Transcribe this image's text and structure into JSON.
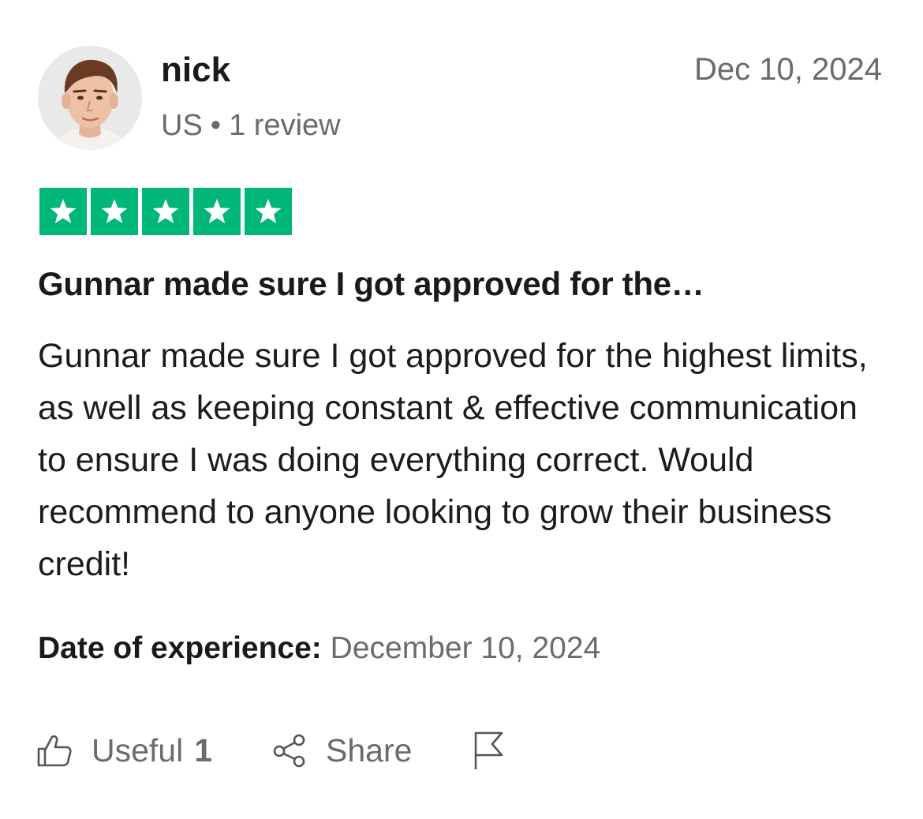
{
  "review": {
    "author": "nick",
    "country": "US",
    "separator": "•",
    "review_count": "1 review",
    "date": "Dec 10, 2024",
    "rating": 5,
    "rating_max": 5,
    "star_color": "#00b67a",
    "title": "Gunnar made sure I got approved for the…",
    "body": "Gunnar made sure I got approved for the highest limits, as well as keeping constant & effective communication to ensure I was doing everything correct. Would recommend to anyone looking to grow their business credit!",
    "experience_label": "Date of experience:",
    "experience_date": "December 10, 2024"
  },
  "actions": {
    "useful_label": "Useful",
    "useful_count": "1",
    "useful_icon": "thumbs-up-icon",
    "share_label": "Share",
    "share_icon": "share-icon",
    "flag_icon": "flag-icon"
  }
}
